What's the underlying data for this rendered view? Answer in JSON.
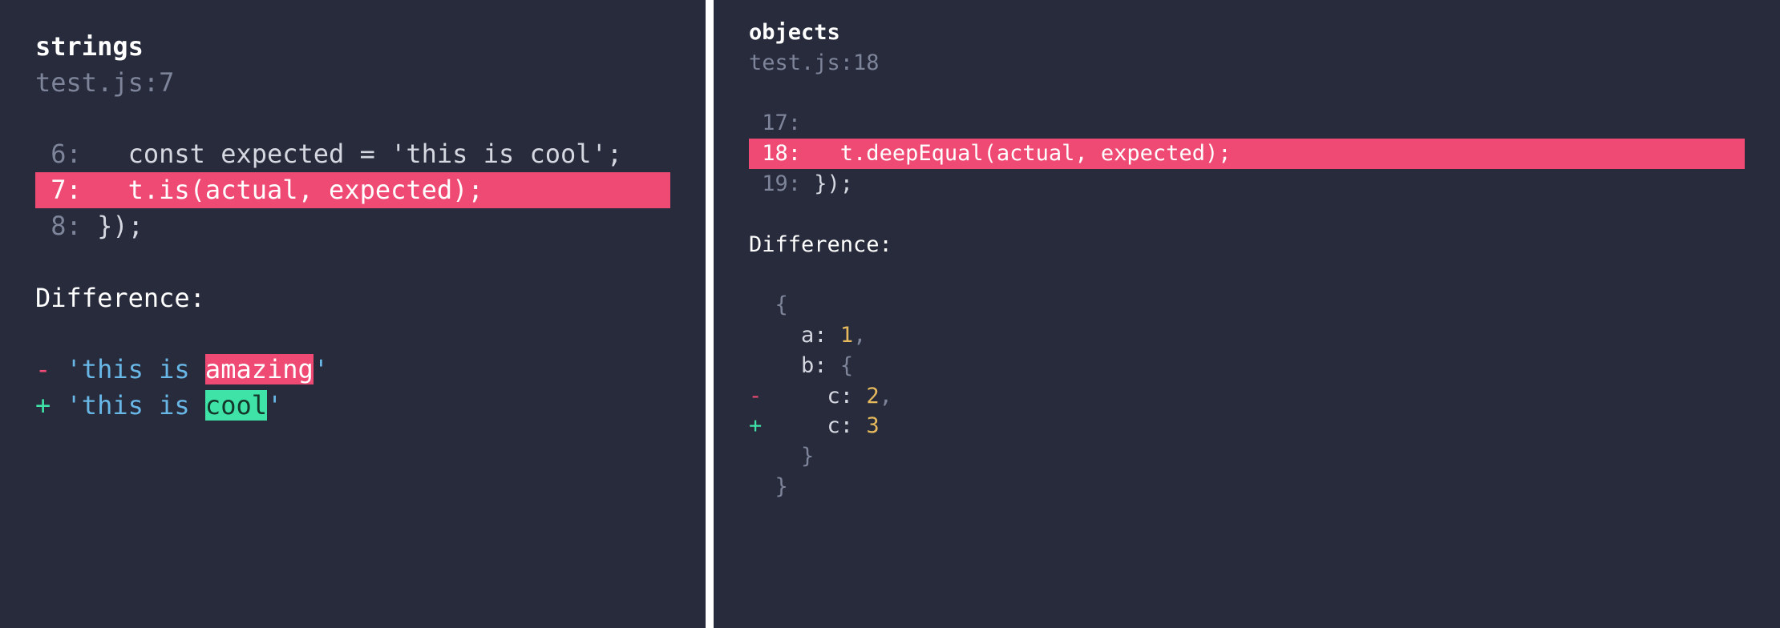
{
  "left": {
    "title": "strings",
    "locator": "test.js:7",
    "code": {
      "l1": {
        "num": " 6:",
        "text": "   const expected = 'this is cool';"
      },
      "l2": {
        "num": " 7:",
        "text": "   t.is(actual, expected);           "
      },
      "l3": {
        "num": " 8:",
        "text": " });"
      }
    },
    "diffLabel": "Difference:",
    "diff": {
      "minus": {
        "sign": "-",
        "pre": " 'this is ",
        "chg": "amazing",
        "post": "'"
      },
      "plus": {
        "sign": "+",
        "pre": " 'this is ",
        "chg": "cool",
        "post": "'"
      }
    }
  },
  "right": {
    "title": "objects",
    "locator": "test.js:18",
    "code": {
      "l1": {
        "num": " 17:",
        "text": ""
      },
      "l2": {
        "num": " 18:",
        "text": "   t.deepEqual(actual, expected);                     "
      },
      "l3": {
        "num": " 19:",
        "text": " });"
      }
    },
    "diffLabel": "Difference:",
    "obj": {
      "open": "  {",
      "a": {
        "indent": "    ",
        "key": "a: ",
        "val": "1",
        "comma": ","
      },
      "bOpen": {
        "indent": "    ",
        "key": "b: ",
        "brace": "{"
      },
      "cDel": {
        "sign": "-",
        "indent": "     ",
        "key": "c: ",
        "val": "2",
        "comma": ","
      },
      "cAdd": {
        "sign": "+",
        "indent": "     ",
        "key": "c: ",
        "val": "3"
      },
      "bClose": "    }",
      "close": "  }"
    }
  }
}
